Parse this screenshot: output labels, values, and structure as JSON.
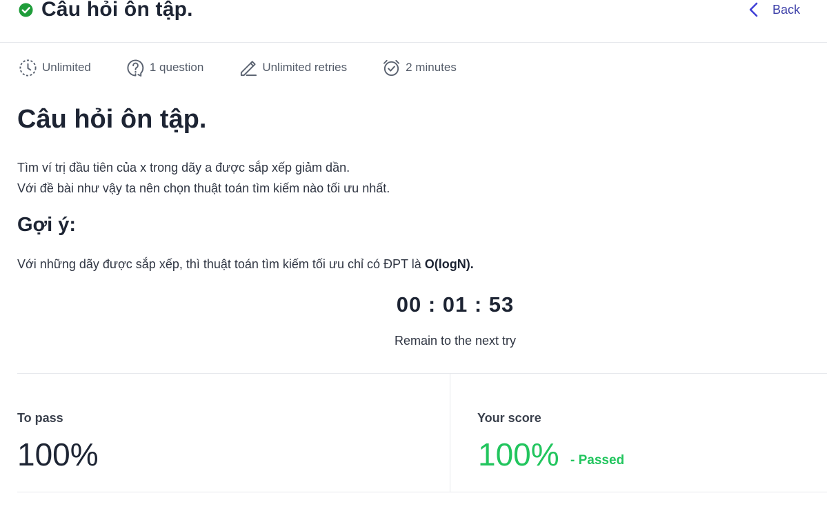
{
  "header": {
    "title": "Câu hỏi ôn tập.",
    "back_label": "Back"
  },
  "meta": {
    "time_limit": "Unlimited",
    "questions": "1 question",
    "retries": "Unlimited retries",
    "duration": "2 minutes"
  },
  "content": {
    "title": "Câu hỏi ôn tập.",
    "description_line1": "Tìm ví trị đầu tiên của x trong dãy a được sắp xếp giảm dần.",
    "description_line2": "Với đề bài như vậy ta nên chọn thuật toán tìm kiếm nào tối ưu nhất.",
    "hint_title": "Gợi ý:",
    "hint_text": "Với những dãy được sắp xếp, thì thuật toán tìm kiếm tối ưu chỉ có ĐPT là",
    "hint_bold": "O(logN)."
  },
  "timer": {
    "value": "00 : 01 : 53",
    "caption": "Remain to the next try"
  },
  "results": {
    "pass_label": "To pass",
    "pass_value": "100%",
    "score_label": "Your score",
    "score_value": "100%",
    "score_status": "- Passed"
  },
  "colors": {
    "accent": "#3f3fd6",
    "success": "#22c55e",
    "text": "#1d2433",
    "check": "#1f9d3a"
  },
  "icons": {
    "title": "check-circle-icon",
    "back": "chevron-left-icon",
    "time_limit": "dashed-clock-icon",
    "questions": "question-bubble-icon",
    "retries": "pencil-edit-icon",
    "duration": "alarm-clock-icon"
  }
}
